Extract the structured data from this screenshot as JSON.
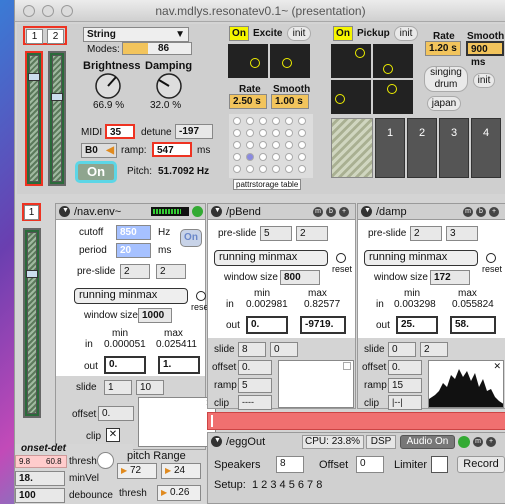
{
  "window": {
    "title": "nav.mdlys.resonatev0.1~ (presentation)"
  },
  "top": {
    "channels": [
      "1",
      "2"
    ],
    "dropdown": "String",
    "modes_label": "Modes:",
    "modes_value": "86",
    "brightness_label": "Brightness",
    "brightness_value": "66.9 %",
    "damping_label": "Damping",
    "damping_value": "32.0 %",
    "midi_label": "MIDI",
    "midi_value": "35",
    "detune_label": "detune",
    "detune_value": "-197",
    "note_value": "B0",
    "ramp_label": "ramp:",
    "ramp_value": "547",
    "ramp_unit": "ms",
    "on_label": "On",
    "pitch_label": "Pitch:",
    "pitch_value": "51.7092 Hz"
  },
  "excite": {
    "on": "On",
    "title": "Excite",
    "init": "init",
    "rate_label": "Rate",
    "rate_value": "2.50 s",
    "smooth_label": "Smooth",
    "smooth_value": "1.00 s",
    "pattr": "pattrstorage table"
  },
  "pickup": {
    "on": "On",
    "title": "Pickup",
    "init": "init",
    "rate_label": "Rate",
    "rate_value": "1.20 s",
    "smooth_label": "Smooth",
    "smooth_value": "900 ms",
    "preset1": "singing drum",
    "preset2": "japan",
    "preset_init": "init",
    "slots": [
      "1",
      "2",
      "3",
      "4"
    ]
  },
  "env": {
    "channel": "1",
    "title": "/nav.env~",
    "cutoff_label": "cutoff",
    "cutoff_value": "850",
    "cutoff_unit": "Hz",
    "period_label": "period",
    "period_value": "20",
    "period_unit": "ms",
    "on": "On",
    "preslide_label": "pre-slide",
    "preslide_a": "2",
    "preslide_b": "2",
    "mode": "running minmax",
    "reset": "reset",
    "window_label": "window size",
    "window_value": "1000",
    "min_label": "min",
    "max_label": "max",
    "in_label": "in",
    "in_min": "0.000051",
    "in_max": "0.025411",
    "out_label": "out",
    "out_min": "0.",
    "out_max": "1.",
    "slide_label": "slide",
    "slide_a": "1",
    "slide_b": "10",
    "offset_label": "offset",
    "offset_value": "0.",
    "clip_label": "clip"
  },
  "pbend": {
    "title": "/pBend",
    "preslide_label": "pre-slide",
    "preslide_a": "5",
    "preslide_b": "2",
    "mode": "running minmax",
    "reset": "reset",
    "window_label": "window size",
    "window_value": "800",
    "min_label": "min",
    "max_label": "max",
    "in_label": "in",
    "in_min": "0.002981",
    "in_max": "0.82577",
    "out_label": "out",
    "out_min": "0.",
    "out_max": "-9719.",
    "slide_label": "slide",
    "slide_a": "8",
    "slide_b": "0",
    "offset_label": "offset",
    "offset_value": "0.",
    "ramp_label": "ramp",
    "ramp_value": "5",
    "clip_label": "clip",
    "clip_value": "----"
  },
  "damp": {
    "title": "/damp",
    "preslide_label": "pre-slide",
    "preslide_a": "2",
    "preslide_b": "3",
    "mode": "running minmax",
    "reset": "reset",
    "window_label": "window size",
    "window_value": "172",
    "min_label": "min",
    "max_label": "max",
    "in_label": "in",
    "in_min": "0.003298",
    "in_max": "0.055824",
    "out_label": "out",
    "out_min": "25.",
    "out_max": "58.",
    "slide_label": "slide",
    "slide_a": "0",
    "slide_b": "2",
    "offset_label": "offset",
    "offset_value": "0.",
    "ramp_label": "ramp",
    "ramp_value": "15",
    "clip_label": "clip",
    "clip_value": "|--|"
  },
  "onset": {
    "title": "onset-det",
    "v1": "9.8",
    "v2": "60.8",
    "thresh_label": "thresh",
    "minvel_value": "18.",
    "minvel_label": "minVel",
    "debounce_value": "100",
    "debounce_label": "debounce"
  },
  "pitchrange": {
    "label": "pitch Range",
    "low": "72",
    "high": "24",
    "thresh_label": "thresh",
    "thresh_value": "0.26"
  },
  "egg": {
    "title": "/eggOut",
    "cpu_label": "CPU:",
    "cpu_value": "23.8%",
    "dsp": "DSP",
    "audio": "Audio On",
    "speakers_label": "Speakers",
    "speakers_value": "8",
    "offset_label": "Offset",
    "offset_value": "0",
    "limiter_label": "Limiter",
    "record": "Record",
    "setup_label": "Setup:",
    "setup_values": "1 2 3 4 5 6 7 8"
  }
}
